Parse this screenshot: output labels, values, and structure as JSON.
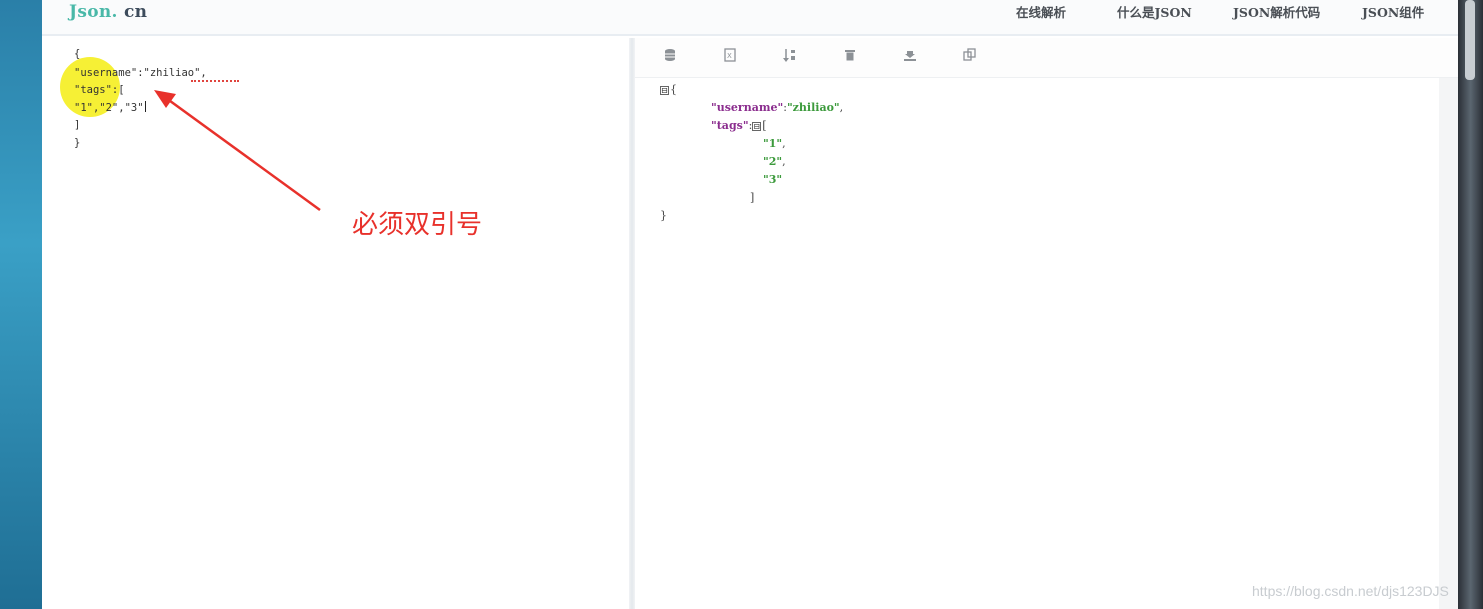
{
  "site": {
    "logo_main": "Json.",
    "logo_suffix": "cn"
  },
  "nav": [
    {
      "label": "在线解析"
    },
    {
      "label": "什么是JSON"
    },
    {
      "label": "JSON解析代码"
    },
    {
      "label": "JSON组件"
    }
  ],
  "editor": {
    "lines": [
      "{",
      "\"username\":\"zhiliao\",",
      "\"tags\":[",
      "\"1\",\"2\",\"3\"",
      "]",
      "}"
    ]
  },
  "toolbar": {
    "icons": [
      "database-icon",
      "excel-icon",
      "sort-icon",
      "trash-icon",
      "download-icon",
      "copy-icon"
    ]
  },
  "tree": {
    "open_brace": "{",
    "username_key": "\"username\"",
    "username_value": "\"zhiliao\"",
    "tags_key": "\"tags\"",
    "open_bracket": "[",
    "items": [
      "\"1\"",
      "\"2\"",
      "\"3\""
    ],
    "close_bracket": "]",
    "close_brace": "}",
    "toggle_symbol": "⊟"
  },
  "annotation": {
    "text": "必须双引号",
    "color": "#e8312b"
  },
  "watermark": "https://blog.csdn.net/djs123DJS",
  "colors": {
    "logo_accent": "#49b8a8",
    "key_color": "#8b2d8e",
    "string_color": "#3c9a3c",
    "highlight": "#f6ef2a"
  }
}
